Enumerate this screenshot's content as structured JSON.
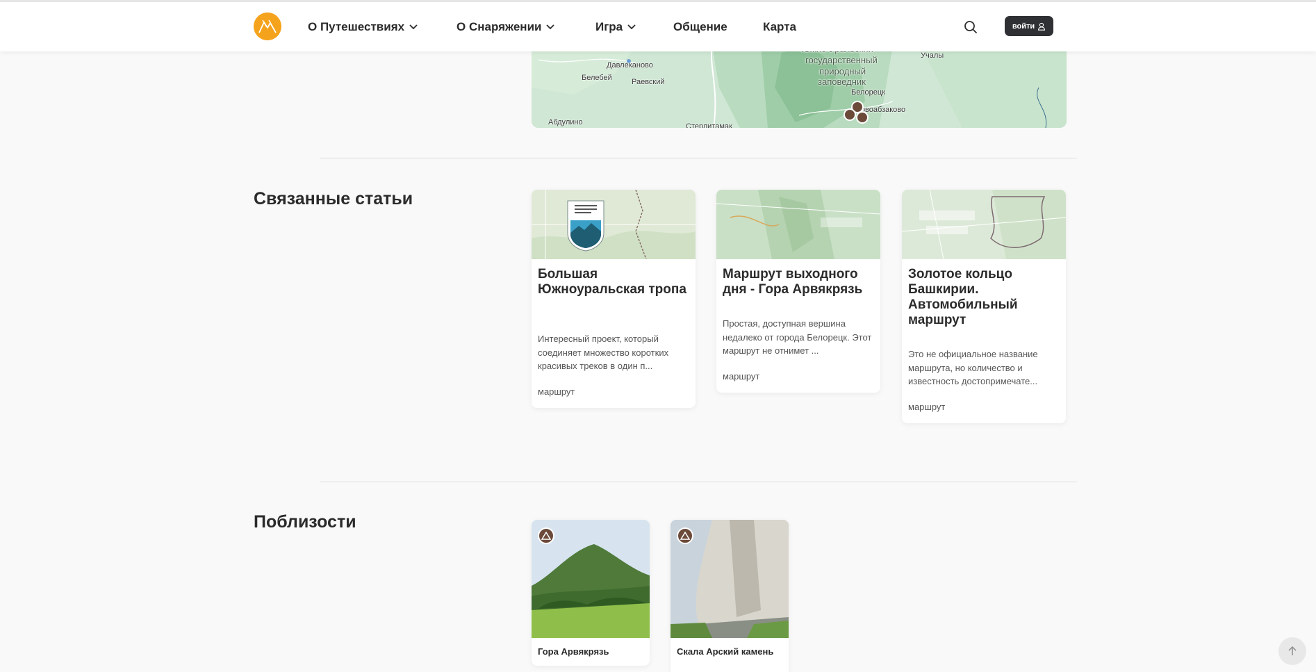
{
  "header": {
    "nav": [
      {
        "label": "О Путешествиях",
        "has_dropdown": true
      },
      {
        "label": "О Снаряжении",
        "has_dropdown": true
      },
      {
        "label": "Игра",
        "has_dropdown": true
      },
      {
        "label": "Общение",
        "has_dropdown": false
      },
      {
        "label": "Карта",
        "has_dropdown": false
      }
    ],
    "login_label": "войти",
    "accent_color": "#f5a31c"
  },
  "map": {
    "labels": {
      "davlekanovo": "Давлеканово",
      "belebey": "Белебей",
      "raevsky": "Раевский",
      "abdulino": "Абдулино",
      "sterlitamak": "Стерлитамак",
      "reserve_1": "Южно-Уральский",
      "reserve_2": "государственный",
      "reserve_3": "природный",
      "reserve_4": "заповедник",
      "beloretsk": "Белорецк",
      "novoabzakovo": "Новоабзаково",
      "uchaly": "Учалы"
    }
  },
  "related": {
    "title": "Связанные статьи",
    "cards": [
      {
        "title": "Большая Южноуральская тропа",
        "description": "Интересный проект, который соединяет множество коротких красивых треков в один п...",
        "tag": "маршрут"
      },
      {
        "title": "Маршрут выходного дня - Гора Арвякрязь",
        "description": "Простая, доступная вершина недалеко от города Белорецк. Этот маршрут не отнимет ...",
        "tag": "маршрут"
      },
      {
        "title": "Золотое кольцо Башкирии. Автомобильный маршрут",
        "description": "Это не официальное название маршрута, но количество и известность достопримечате...",
        "tag": "маршрут"
      }
    ]
  },
  "nearby": {
    "title": "Поблизости",
    "items": [
      {
        "title": "Гора Арвякрязь",
        "icon": "mountain-icon"
      },
      {
        "title": "Скала Арский камень",
        "icon": "mountain-icon"
      }
    ]
  }
}
